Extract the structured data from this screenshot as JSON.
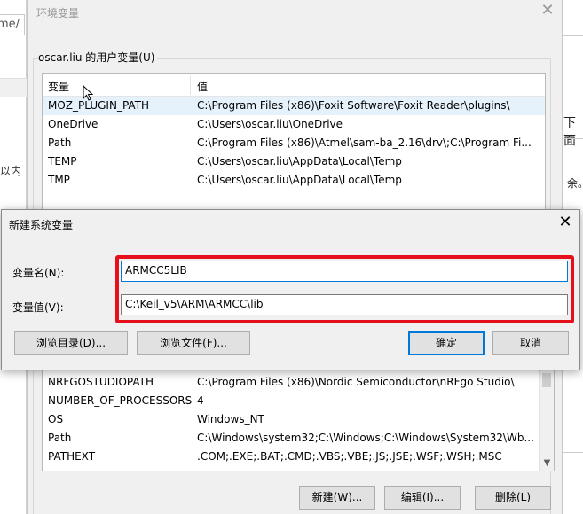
{
  "background": {
    "left_address_fragment": "me/",
    "left_text_fragment": "以内",
    "right_text_fragment_1": "下面",
    "right_text_fragment_2": "余。"
  },
  "env_window": {
    "title": "环境变量",
    "user_group_label": "oscar.liu 的用户变量(U)",
    "columns": {
      "variable": "变量",
      "value": "值"
    },
    "user_vars": [
      {
        "name": "MOZ_PLUGIN_PATH",
        "value": "C:\\Program Files (x86)\\Foxit Software\\Foxit Reader\\plugins\\"
      },
      {
        "name": "OneDrive",
        "value": "C:\\Users\\oscar.liu\\OneDrive"
      },
      {
        "name": "Path",
        "value": "C:\\Program Files (x86)\\Atmel\\sam-ba_2.16\\drv\\;C:\\Program Fi..."
      },
      {
        "name": "TEMP",
        "value": "C:\\Users\\oscar.liu\\AppData\\Local\\Temp"
      },
      {
        "name": "TMP",
        "value": "C:\\Users\\oscar.liu\\AppData\\Local\\Temp"
      }
    ],
    "system_vars": [
      {
        "name": "NRFGOSTUDIOPATH",
        "value": "C:\\Program Files (x86)\\Nordic Semiconductor\\nRFgo Studio\\"
      },
      {
        "name": "NUMBER_OF_PROCESSORS",
        "value": "4"
      },
      {
        "name": "OS",
        "value": "Windows_NT"
      },
      {
        "name": "Path",
        "value": "C:\\Windows\\system32;C:\\Windows;C:\\Windows\\System32\\Wb..."
      },
      {
        "name": "PATHEXT",
        "value": ".COM;.EXE;.BAT;.CMD;.VBS;.VBE;.JS;.JSE;.WSF;.WSH;.MSC"
      }
    ],
    "buttons": {
      "new": "新建(W)...",
      "edit": "编辑(I)...",
      "delete": "删除(L)"
    }
  },
  "dialog": {
    "title": "新建系统变量",
    "name_label": "变量名(N):",
    "name_value": "ARMCC5LIB",
    "value_label": "变量值(V):",
    "value_value": "C:\\Keil_v5\\ARM\\ARMCC\\lib",
    "browse_dir": "浏览目录(D)...",
    "browse_file": "浏览文件(F)...",
    "ok": "确定",
    "cancel": "取消"
  },
  "colors": {
    "accent": "#0078d7",
    "highlight": "#e5101c",
    "selection": "#e5f1fb"
  }
}
